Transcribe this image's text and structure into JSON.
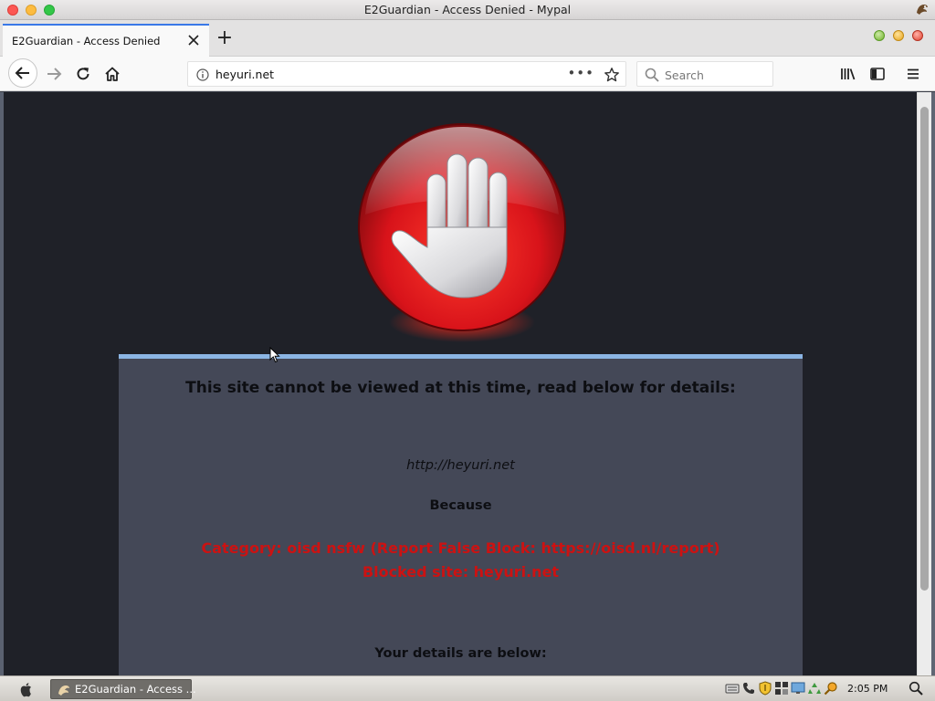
{
  "window": {
    "title": "E2Guardian - Access Denied - Mypal"
  },
  "tabs": [
    {
      "label": "E2Guardian - Access Denied",
      "active": true
    }
  ],
  "toolbar": {
    "tab_close_icon": "close-icon",
    "new_tab_label": "+",
    "back_icon": "arrow-left-icon",
    "forward_icon": "arrow-right-icon",
    "reload_icon": "reload-icon",
    "home_icon": "home-icon",
    "page_actions_label": "•••",
    "library_icon": "library-icon",
    "sidebar_icon": "sidebar-icon",
    "menu_icon": "hamburger-menu-icon"
  },
  "urlbar": {
    "url": "heyuri.net"
  },
  "search": {
    "placeholder": "Search"
  },
  "page": {
    "headline": "This site cannot be viewed at this time, read below for details:",
    "blocked_url": "http://heyuri.net",
    "because_label": "Because",
    "reason_category": "Category: oisd nsfw (Report False Block: https://oisd.nl/report)",
    "reason_site": "Blocked site: heyuri.net",
    "details_label": "Your details are below:"
  },
  "taskbar": {
    "task_label": "E2Guardian - Access ...",
    "clock": "2:05 PM"
  },
  "colors": {
    "page_background": "#1f2128",
    "panel_background": "#444857",
    "panel_accent": "#8bb5e4",
    "error_text": "#cc1212",
    "tab_accent": "#3a79e8"
  }
}
